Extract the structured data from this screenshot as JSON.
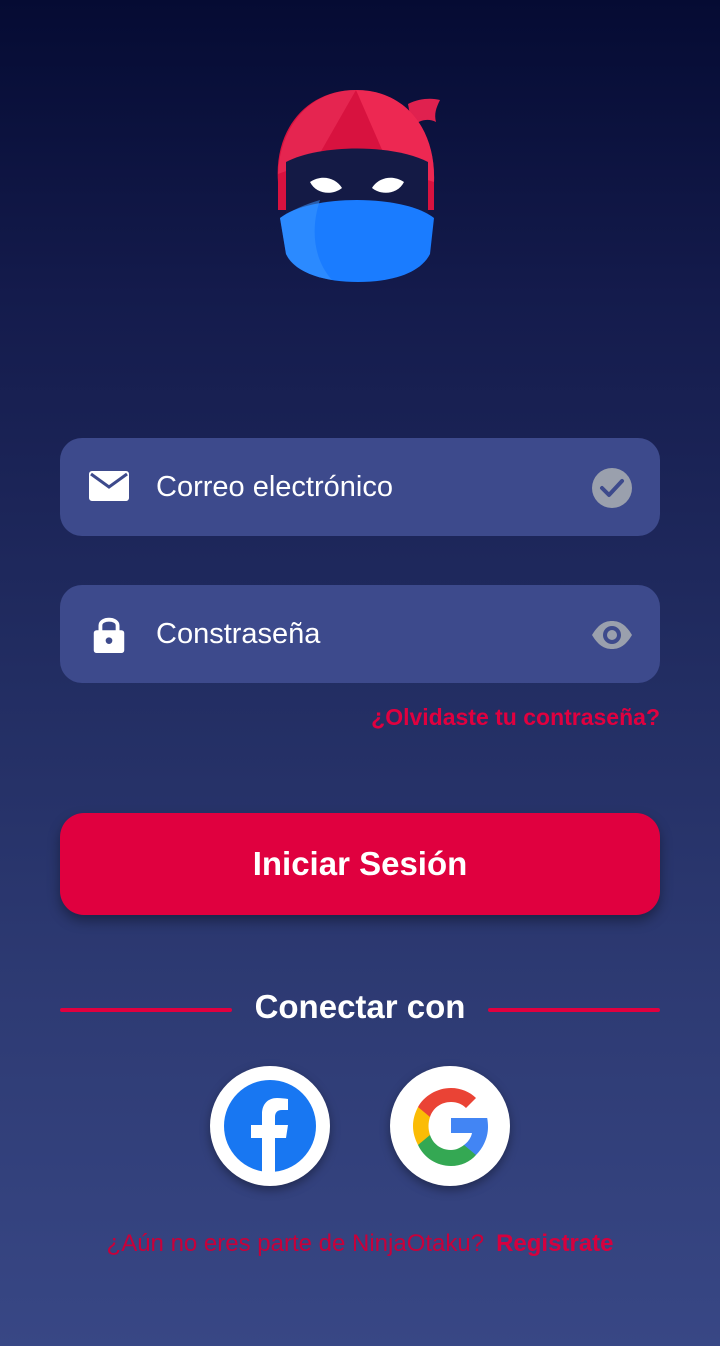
{
  "brand": {
    "logo_icon": "ninja-mascot-icon",
    "colors": {
      "accent": "#e0003f",
      "field_bg": "#3d4a8c",
      "background_top": "#050b33",
      "background_bottom": "#384785"
    }
  },
  "login_form": {
    "email": {
      "placeholder": "Correo electrónico",
      "value": "",
      "lead_icon": "mail-icon",
      "trail_icon": "check-circle-icon"
    },
    "password": {
      "placeholder": "Constraseña",
      "value": "",
      "lead_icon": "lock-icon",
      "trail_icon": "eye-icon"
    },
    "forgot_password_label": "¿Olvidaste tu contraseña?",
    "submit_label": "Iniciar Sesión"
  },
  "social_login": {
    "label": "Conectar con",
    "providers": [
      {
        "name": "facebook",
        "icon": "facebook-icon"
      },
      {
        "name": "google",
        "icon": "google-icon"
      }
    ]
  },
  "register": {
    "question": "¿Aún no eres parte de NinjaOtaku?",
    "link_label": "Registrate"
  }
}
